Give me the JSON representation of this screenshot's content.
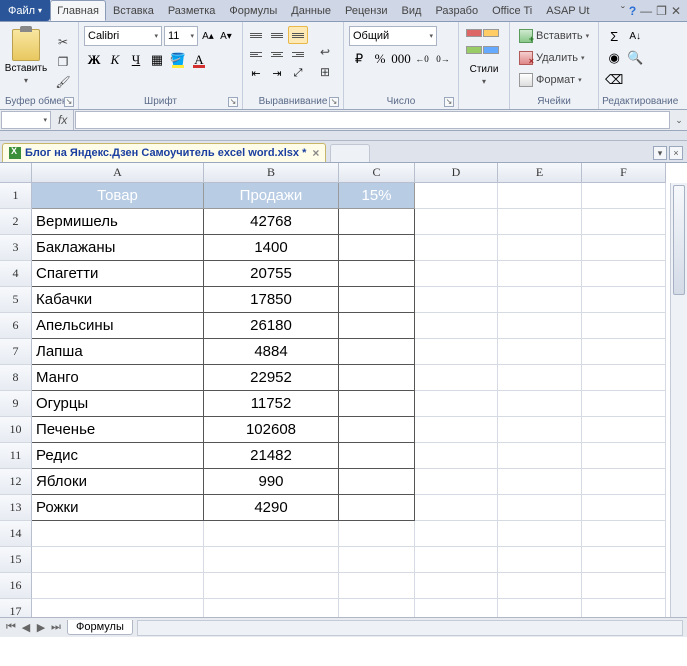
{
  "tabs": {
    "file": "Файл",
    "list": [
      "Главная",
      "Вставка",
      "Разметка",
      "Формулы",
      "Данные",
      "Рецензи",
      "Вид",
      "Разрабо",
      "Office Ti",
      "ASAP Ut"
    ],
    "active_index": 0
  },
  "ribbon": {
    "clipboard": {
      "paste": "Вставить",
      "label": "Буфер обмена"
    },
    "font": {
      "name": "Calibri",
      "size": "11",
      "label": "Шрифт"
    },
    "alignment": {
      "label": "Выравнивание"
    },
    "number": {
      "format": "Общий",
      "label": "Число"
    },
    "styles": {
      "btn": "Стили",
      "label": ""
    },
    "cells": {
      "insert": "Вставить",
      "delete": "Удалить",
      "format": "Формат",
      "label": "Ячейки"
    },
    "editing": {
      "label": "Редактирование"
    }
  },
  "formula_bar": {
    "name_box": "",
    "fx": "fx",
    "formula": ""
  },
  "workbook_tab": {
    "title": "Блог на Яндекс.Дзен Самоучитель excel word.xlsx *"
  },
  "columns": [
    "A",
    "B",
    "C",
    "D",
    "E",
    "F"
  ],
  "table": {
    "headers": [
      "Товар",
      "Продажи",
      "15%"
    ],
    "rows": [
      {
        "a": "Вермишель",
        "b": "42768",
        "c": ""
      },
      {
        "a": "Баклажаны",
        "b": "1400",
        "c": ""
      },
      {
        "a": "Спагетти",
        "b": "20755",
        "c": ""
      },
      {
        "a": "Кабачки",
        "b": "17850",
        "c": ""
      },
      {
        "a": "Апельсины",
        "b": "26180",
        "c": ""
      },
      {
        "a": "Лапша",
        "b": "4884",
        "c": ""
      },
      {
        "a": "Манго",
        "b": "22952",
        "c": ""
      },
      {
        "a": "Огурцы",
        "b": "11752",
        "c": ""
      },
      {
        "a": "Печенье",
        "b": "102608",
        "c": ""
      },
      {
        "a": "Редис",
        "b": "21482",
        "c": ""
      },
      {
        "a": "Яблоки",
        "b": "990",
        "c": ""
      },
      {
        "a": "Рожки",
        "b": "4290",
        "c": ""
      }
    ]
  },
  "sheet_tabs": {
    "active": "Формулы"
  },
  "row_count_visible": 18
}
